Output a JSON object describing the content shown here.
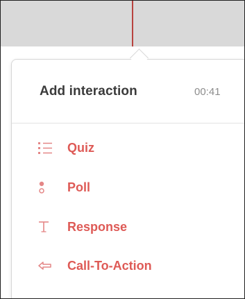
{
  "popover": {
    "title": "Add interaction",
    "timestamp": "00:41"
  },
  "menu": {
    "items": [
      {
        "label": "Quiz",
        "icon": "list-icon"
      },
      {
        "label": "Poll",
        "icon": "poll-icon"
      },
      {
        "label": "Response",
        "icon": "text-icon"
      },
      {
        "label": "Call-To-Action",
        "icon": "arrow-left-icon"
      }
    ]
  },
  "colors": {
    "accent": "#de5a56",
    "icon": "#e48686",
    "playhead": "#b8433f",
    "timeline_background": "#d9d9d9",
    "title": "#3b3b3b",
    "timestamp": "#8d8d8d"
  }
}
